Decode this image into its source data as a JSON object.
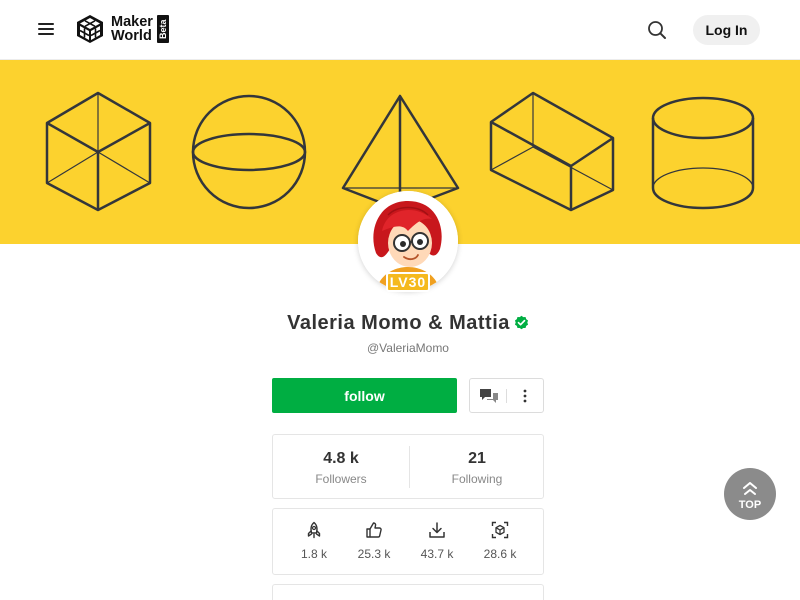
{
  "header": {
    "logo_line1": "Maker",
    "logo_line2": "World",
    "logo_badge": "Beta",
    "login_label": "Log In",
    "icons": [
      "menu-icon",
      "search-icon"
    ]
  },
  "banner": {
    "background": "#fcd22e",
    "shapes": [
      "cube",
      "sphere",
      "pyramid",
      "rectangular-prism",
      "cylinder"
    ]
  },
  "profile": {
    "level_badge": "LV30",
    "name": "Valeria Momo & Mattia",
    "handle": "@ValeriaMomo",
    "verified_color": "#00ae42"
  },
  "actions": {
    "follow_label": "follow",
    "follow_color": "#00ae42",
    "icons": [
      "chat-icon",
      "more-icon"
    ]
  },
  "follow_stats": {
    "followers_value": "4.8 k",
    "followers_label": "Followers",
    "following_value": "21",
    "following_label": "Following"
  },
  "stats": [
    {
      "icon": "rocket-icon",
      "value": "1.8 k"
    },
    {
      "icon": "thumbs-up-icon",
      "value": "25.3 k"
    },
    {
      "icon": "download-icon",
      "value": "43.7 k"
    },
    {
      "icon": "print-scan-icon",
      "value": "28.6 k"
    }
  ],
  "top_button": {
    "label": "TOP"
  }
}
